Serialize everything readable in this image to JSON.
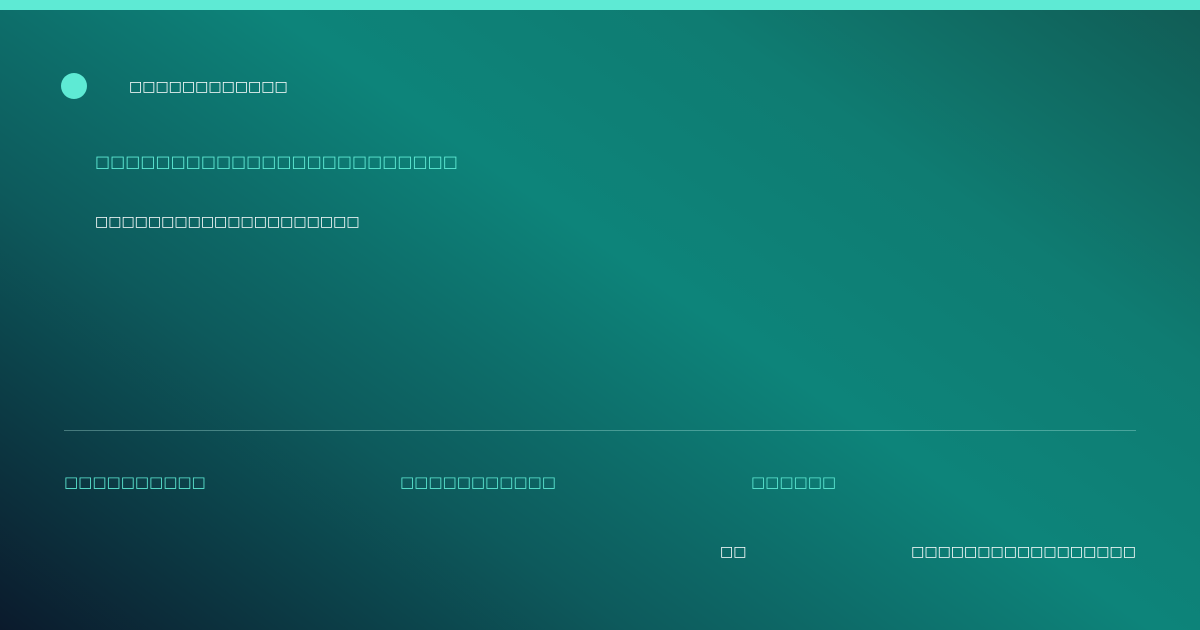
{
  "colors": {
    "accent": "#5eead4",
    "text_primary": "#ffffff"
  },
  "brand": {
    "icon": "brand-dot-icon",
    "name": "□□□□□□□□□□□□"
  },
  "hero": {
    "headline": "□□□□□□□□□□□□□□□□□□□□□□□□",
    "subline": "□□□□□□□□□□□□□□□□□□□□"
  },
  "meta": {
    "items": [
      {
        "label": "□□□□□□□□□□"
      },
      {
        "label": "□□□□□□□□□□□"
      },
      {
        "label": "□□□□□□"
      }
    ]
  },
  "footer": {
    "short_text": "□□",
    "long_text": "□□□□□□□□□□□□□□□□□"
  }
}
